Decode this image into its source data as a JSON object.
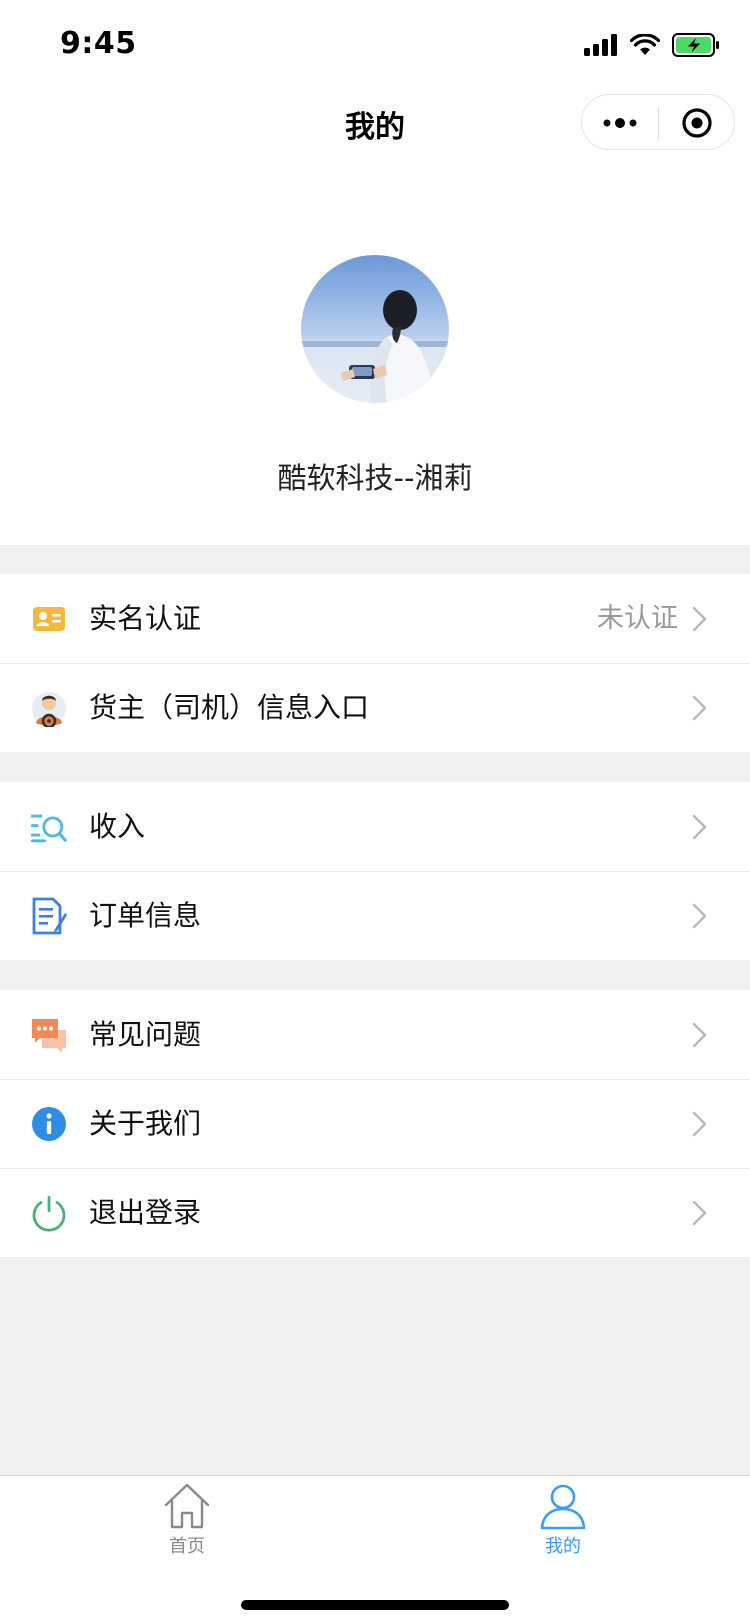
{
  "status": {
    "time": "9:45"
  },
  "nav": {
    "title": "我的"
  },
  "profile": {
    "name": "酷软科技--湘莉"
  },
  "groups": [
    {
      "items": [
        {
          "label": "实名认证",
          "value": "未认证",
          "icon": "id-card-icon"
        },
        {
          "label": "货主（司机）信息入口",
          "value": "",
          "icon": "driver-icon"
        }
      ]
    },
    {
      "items": [
        {
          "label": "收入",
          "value": "",
          "icon": "income-search-icon"
        },
        {
          "label": "订单信息",
          "value": "",
          "icon": "order-document-icon"
        }
      ]
    },
    {
      "items": [
        {
          "label": "常见问题",
          "value": "",
          "icon": "faq-chat-icon"
        },
        {
          "label": "关于我们",
          "value": "",
          "icon": "info-icon"
        },
        {
          "label": "退出登录",
          "value": "",
          "icon": "power-icon"
        }
      ]
    }
  ],
  "tabbar": {
    "tabs": [
      {
        "label": "首页",
        "icon": "home-icon",
        "active": false
      },
      {
        "label": "我的",
        "icon": "user-icon",
        "active": true
      }
    ],
    "active_color": "#3b9cf0",
    "inactive_color": "#8a8a8a"
  }
}
